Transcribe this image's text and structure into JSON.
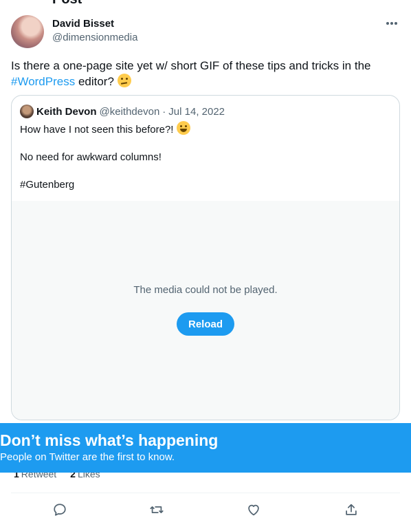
{
  "clipped_heading": "Post",
  "author": {
    "name": "David Bisset",
    "handle": "@dimensionmedia"
  },
  "tweet": {
    "text_before": "Is there a one-page site yet w/ short GIF of these tips and tricks in the ",
    "hashtag": "#WordPress",
    "text_after": " editor?",
    "emoji": "thinking-face"
  },
  "quoted": {
    "name": "Keith Devon",
    "handle": "@keithdevon",
    "separator": "·",
    "date": "Jul 14, 2022",
    "line1": "How have I not seen this before?!",
    "line1_emoji": "grinning-face",
    "line2": "No need for awkward columns!",
    "line3": "#Gutenberg",
    "media_message": "The media could not be played.",
    "reload_label": "Reload"
  },
  "stats": {
    "retweets_count": "1",
    "retweets_label": "Retweet",
    "likes_count": "2",
    "likes_label": "Likes"
  },
  "actions": [
    "reply-icon",
    "retweet-icon",
    "like-icon",
    "share-icon"
  ],
  "banner": {
    "title": "Don’t miss what’s happening",
    "subtitle": "People on Twitter are the first to know."
  },
  "colors": {
    "accent": "#1d9bf0",
    "text": "#0f1419",
    "secondary": "#536471",
    "border": "#cfd9de",
    "media_bg": "#f7f9f9"
  }
}
